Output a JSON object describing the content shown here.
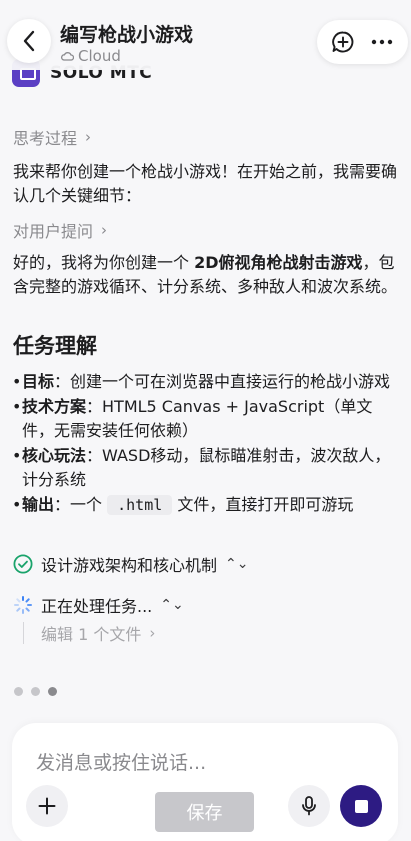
{
  "header": {
    "title": "编写枪战小游戏",
    "subtitle": "Cloud"
  },
  "agent": {
    "name": "SOLO MTC"
  },
  "thinking_link": "思考过程",
  "intro_text": "我来帮你创建一个枪战小游戏！在开始之前，我需要确认几个关键细节：",
  "ask_user_link": "对用户提问",
  "answer": {
    "prefix": "好的，我将为你创建一个 ",
    "emphasis": "2D俯视角枪战射击游戏",
    "suffix": "，包含完整的游戏循环、计分系统、多种敌人和波次系统。"
  },
  "section_title": "任务理解",
  "bullets": [
    {
      "label": "目标",
      "text": "：创建一个可在浏览器中直接运行的枪战小游戏"
    },
    {
      "label": "技术方案",
      "text": "：HTML5 Canvas + JavaScript（单文件，无需安装任何依赖）"
    },
    {
      "label": "核心玩法",
      "text": "：WASD移动，鼠标瞄准射击，波次敌人，计分系统"
    },
    {
      "label": "输出",
      "text_before": "：一个 ",
      "code": ".html",
      "text_after": " 文件，直接打开即可游玩"
    }
  ],
  "steps": {
    "done": "设计游戏架构和核心机制",
    "running": "正在处理任务...",
    "substep": "编辑 1 个文件"
  },
  "composer": {
    "placeholder": "发消息或按住说话...",
    "save_label": "保存"
  },
  "colors": {
    "accent": "#2d1b83",
    "success": "#1aa36b",
    "spinner": "#3b82f6"
  }
}
